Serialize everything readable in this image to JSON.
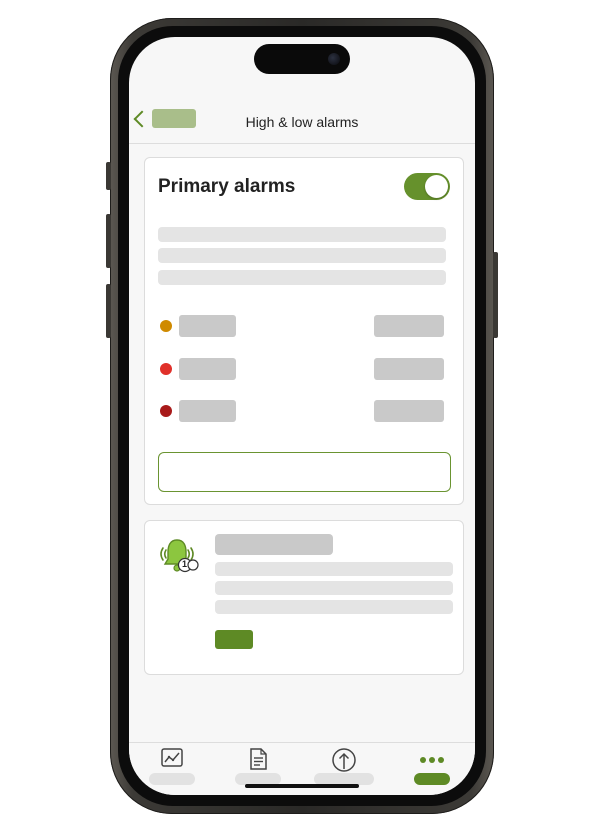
{
  "header": {
    "title": "High & low alarms",
    "back_label": ""
  },
  "primary_card": {
    "title": "Primary alarms",
    "toggle_on": true,
    "alarm_levels": [
      {
        "color": "#cf8a00"
      },
      {
        "color": "#e0302a"
      },
      {
        "color": "#a81a1a"
      }
    ],
    "button_label": ""
  },
  "secondary_card": {
    "icon": "bell-alarm-icon",
    "badge_number": "1",
    "button_label": ""
  },
  "tab_bar": {
    "tabs": [
      {
        "icon": "chart-icon",
        "label": "",
        "active": false
      },
      {
        "icon": "document-icon",
        "label": "",
        "active": false
      },
      {
        "icon": "upload-icon",
        "label": "",
        "active": false
      },
      {
        "icon": "more-icon",
        "label": "",
        "active": true
      }
    ]
  },
  "colors": {
    "accent": "#5e8a25",
    "toggle_on": "#66912c",
    "screen_bg": "#f7f7f7"
  }
}
